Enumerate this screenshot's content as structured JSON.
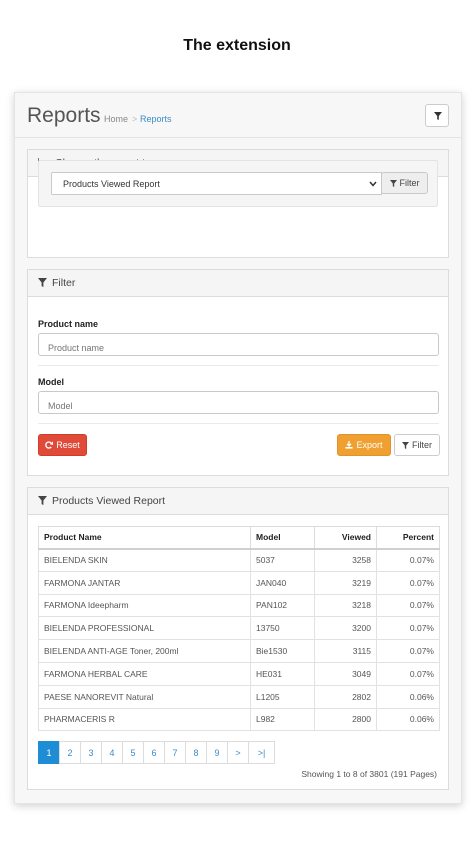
{
  "page_heading": "The extension",
  "header": {
    "title": "Reports",
    "breadcrumb": {
      "home": "Home",
      "separator": ">",
      "current": "Reports"
    }
  },
  "report_type": {
    "title": "Choose the report type",
    "selected": "Products Viewed Report",
    "filter_button": "Filter"
  },
  "filter": {
    "title": "Filter",
    "product_name": {
      "label": "Product name",
      "placeholder": "Product name"
    },
    "model": {
      "label": "Model",
      "placeholder": "Model"
    },
    "reset_button": "Reset",
    "export_button": "Export",
    "filter_button": "Filter"
  },
  "report": {
    "title": "Products Viewed Report",
    "columns": [
      "Product Name",
      "Model",
      "Viewed",
      "Percent"
    ],
    "rows": [
      [
        "BIELENDA SKIN",
        "5037",
        "3258",
        "0.07%"
      ],
      [
        "FARMONA JANTAR",
        "JAN040",
        "3219",
        "0.07%"
      ],
      [
        "FARMONA Ideepharm",
        "PAN102",
        "3218",
        "0.07%"
      ],
      [
        "BIELENDA PROFESSIONAL",
        "13750",
        "3200",
        "0.07%"
      ],
      [
        "BIELENDA ANTI-AGE Toner, 200ml",
        "Bie1530",
        "3115",
        "0.07%"
      ],
      [
        "FARMONA HERBAL CARE",
        "HE031",
        "3049",
        "0.07%"
      ],
      [
        "PAESE NANOREVIT Natural",
        "L1205",
        "2802",
        "0.06%"
      ],
      [
        "PHARMACERIS R",
        "L982",
        "2800",
        "0.06%"
      ]
    ],
    "pagination": [
      "1",
      "2",
      "3",
      "4",
      "5",
      "6",
      "7",
      "8",
      "9",
      ">",
      ">|"
    ],
    "current_page": "1",
    "summary": "Showing 1 to 8 of 3801 (191 Pages)"
  },
  "colors": {
    "link": "#3a8ccc",
    "reset": "#e04b39",
    "export": "#f0a030",
    "active_page": "#1f8dd6"
  },
  "icons": {
    "funnel": "filter-icon",
    "chart": "bar-chart-icon",
    "refresh": "refresh-icon",
    "download": "download-icon",
    "chevron": "chevron-down-icon"
  }
}
